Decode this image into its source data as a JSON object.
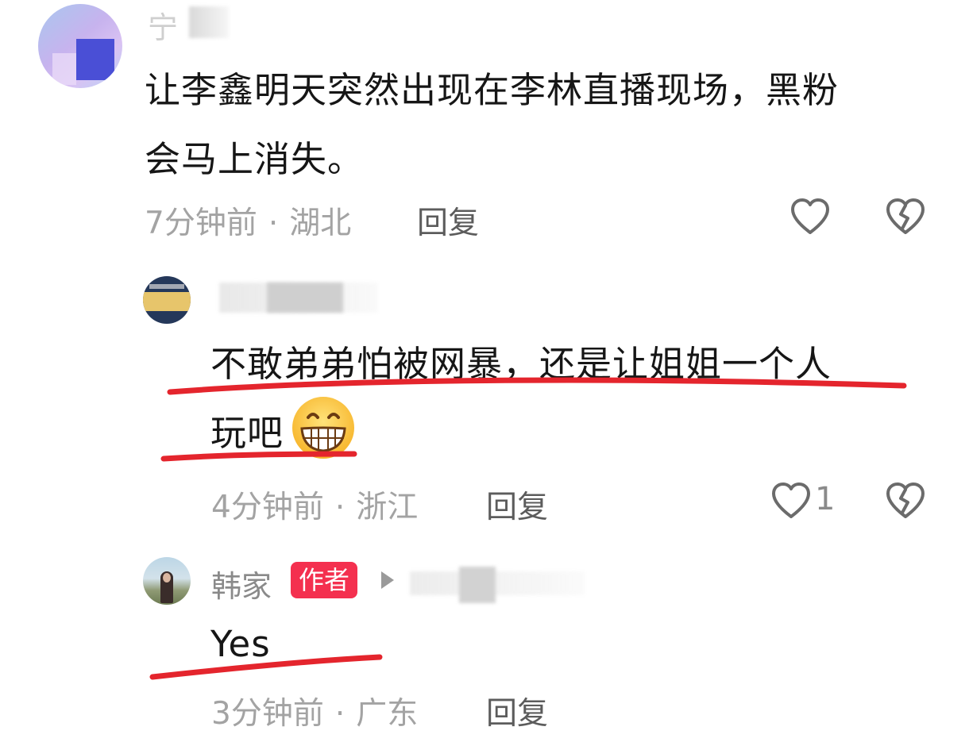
{
  "comments": [
    {
      "username": "宁",
      "text_line1": "让李鑫明天突然出现在李林直播现场，黑粉",
      "text_line2": "会马上消失。",
      "time": "7分钟前",
      "location": "湖北",
      "reply_label": "回复"
    },
    {
      "username": "",
      "text_line1": "不敢弟弟怕被网暴，还是让姐姐一个人",
      "text_line2": "玩吧",
      "emoji": "grinning-face-emoji",
      "time": "4分钟前",
      "location": "浙江",
      "reply_label": "回复",
      "like_count": "1"
    },
    {
      "username": "韩家",
      "badge": "作者",
      "text": "Yes",
      "time": "3分钟前",
      "location": "广东",
      "reply_label": "回复"
    }
  ],
  "meta_separator": "·",
  "colors": {
    "underline": "#e4252d",
    "badge": "#f4304f",
    "meta_text": "#a3a3a3",
    "reply_text": "#5c5c5c"
  },
  "icons": {
    "like": "heart-outline-icon",
    "dislike": "broken-heart-icon",
    "reply_arrow": "play-arrow-icon"
  }
}
